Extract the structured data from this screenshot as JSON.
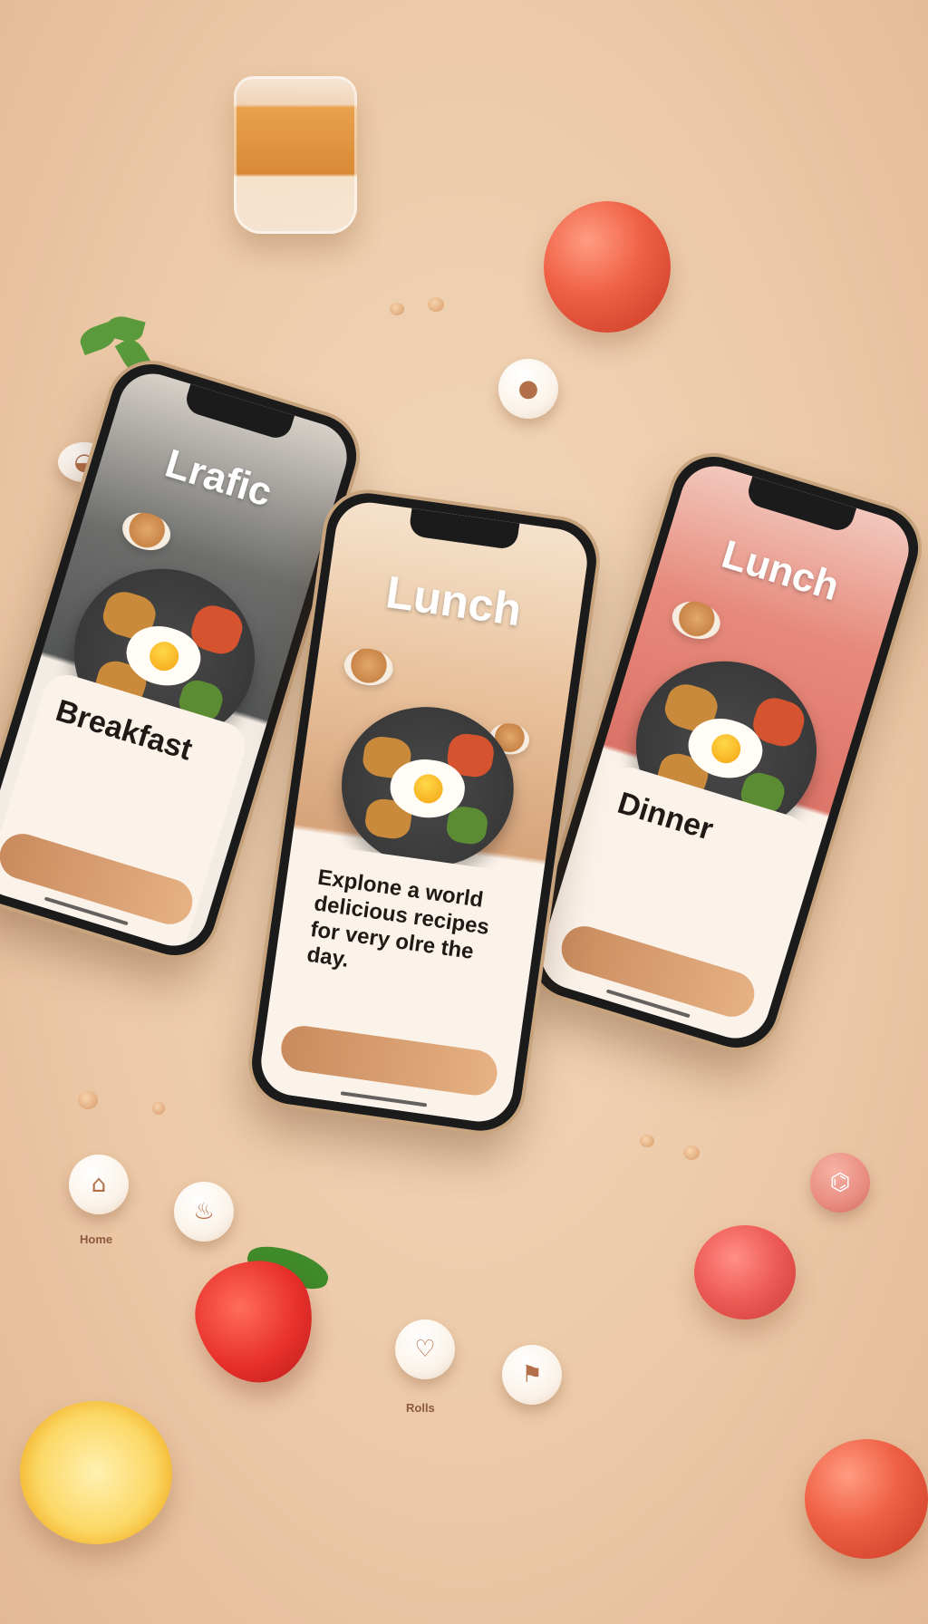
{
  "scene": {
    "background_color": "#ecc9a8",
    "accent_color": "#c98b5e"
  },
  "phones": {
    "left": {
      "heading": "Lrafic",
      "card_title": "Breakfast"
    },
    "center": {
      "heading": "Lunch",
      "card_title": "Explone a world delicious recipes for very olre the day."
    },
    "right": {
      "heading": "Lunch",
      "card_title": "Dinner"
    }
  },
  "nav_chips": [
    {
      "label": "Home",
      "icon": "home-icon"
    },
    {
      "label": "",
      "icon": "chef-icon"
    },
    {
      "label": "Rolls",
      "icon": "heart-icon"
    },
    {
      "label": "",
      "icon": "bookmark-icon"
    },
    {
      "label": "",
      "icon": "basket-icon"
    }
  ]
}
